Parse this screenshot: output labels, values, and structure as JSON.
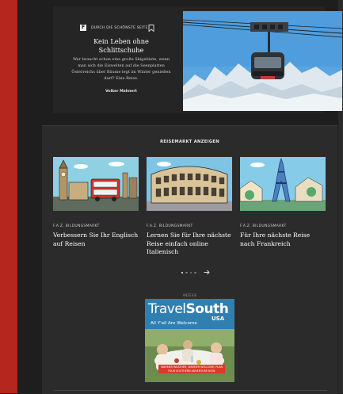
{
  "colors": {
    "accent_bar": "#b5261e",
    "background": "#1e1e1e",
    "box": "#2b2b2b"
  },
  "article": {
    "kicker": "DURCH DIE SCHÖNSTE SEITE",
    "kicker_logo": "F",
    "bookmark_icon": "bookmark-icon",
    "title": "Kein Leben ohne Schlittschuhe",
    "teaser": "Wer braucht schon eine große Skigebiete, wenn man sich die Eiswelten auf die Seenplatten Österreichs über Bäume legt im Winter genießen darf? Eine Reise.",
    "author": "Volker Mahnert"
  },
  "reisemarkt": {
    "title": "REISEMARKT ANZEIGEN",
    "cards": [
      {
        "category": "F.A.Z. BILDUNGSMARKT",
        "headline": "Verbessern Sie Ihr Englisch auf Reisen"
      },
      {
        "category": "F.A.Z. BILDUNGSMARKT",
        "headline": "Lernen Sie für Ihre nächste Reise einfach online Italienisch"
      },
      {
        "category": "F.A.Z. BILDUNGSMARKT",
        "headline": "Für Ihre nächste Reise nach Frankreich"
      }
    ],
    "carousel_active_index": 0,
    "next_icon": "arrow-right-icon"
  },
  "ad": {
    "label": "ANZEIGE",
    "brand_a": "Travel",
    "brand_b": "South",
    "brand_c": "USA",
    "tagline": "All Y'all Are Welcome",
    "cta": "WARMER WEATHER, WARMER WELCOME. PLAN YOUR SOUTHERN ADVENTURE NOW."
  }
}
